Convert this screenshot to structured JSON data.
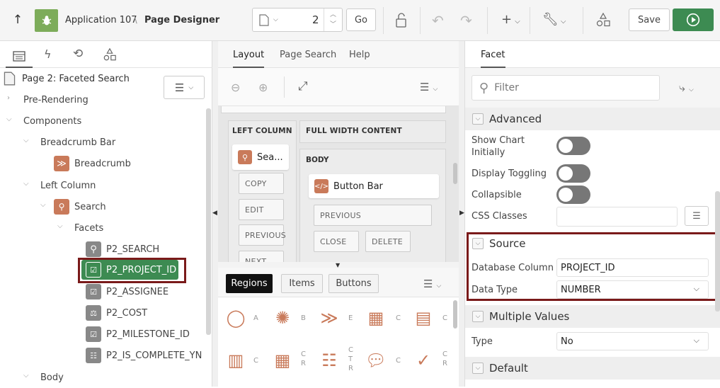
{
  "topbar": {
    "app_label": "Application 107",
    "separator": "\\",
    "page_designer": "Page Designer",
    "page_number": "2",
    "go": "Go",
    "save": "Save"
  },
  "left": {
    "page_title": "Page 2: Faceted Search",
    "tree": {
      "pre_rendering": "Pre-Rendering",
      "components": "Components",
      "breadcrumb_bar": "Breadcrumb Bar",
      "breadcrumb": "Breadcrumb",
      "left_column": "Left Column",
      "search": "Search",
      "facets": "Facets",
      "p2_search": "P2_SEARCH",
      "p2_project_id": "P2_PROJECT_ID",
      "p2_assignee": "P2_ASSIGNEE",
      "p2_cost": "P2_COST",
      "p2_milestone_id": "P2_MILESTONE_ID",
      "p2_is_complete_yn": "P2_IS_COMPLETE_YN",
      "body": "Body"
    }
  },
  "middle": {
    "tabs": [
      "Layout",
      "Page Search",
      "Help"
    ],
    "left_column_label": "LEFT COLUMN",
    "full_width_label": "FULL WIDTH CONTENT",
    "body_label": "BODY",
    "search_region": "Sea...",
    "left_buttons": [
      "COPY",
      "EDIT",
      "PREVIOUS",
      "NEXT"
    ],
    "button_bar": "Button Bar",
    "body_buttons": {
      "previous": "PREVIOUS",
      "close": "CLOSE",
      "delete": "DELETE"
    },
    "gallery_tabs": [
      "Regions",
      "Items",
      "Buttons"
    ],
    "gallery_row1": [
      "A",
      "B",
      "E",
      "C",
      "C",
      "C"
    ],
    "gallery_row2": [
      "C",
      "C\nR",
      "C\nT\nR",
      "C",
      "C\nR"
    ]
  },
  "right": {
    "tab": "Facet",
    "filter_placeholder": "Filter",
    "sections": {
      "advanced": "Advanced",
      "source": "Source",
      "multiple_values": "Multiple Values",
      "default": "Default"
    },
    "props": {
      "show_chart": "Show Chart\nInitially",
      "display_toggling": "Display Toggling",
      "collapsible": "Collapsible",
      "css_classes": "CSS Classes",
      "database_column": "Database Column",
      "database_column_value": "PROJECT_ID",
      "data_type": "Data Type",
      "data_type_value": "NUMBER",
      "type": "Type",
      "type_value": "No"
    }
  },
  "colors": {
    "green": "#3d8b52",
    "highlight_border": "#7a1a1a",
    "icon_orange": "#c97a5a",
    "icon_gray": "#888888"
  }
}
